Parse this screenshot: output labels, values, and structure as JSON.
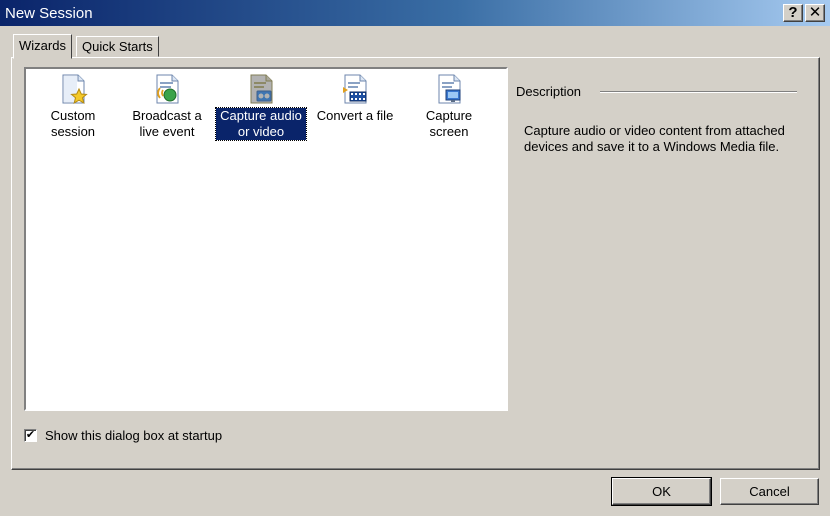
{
  "window": {
    "title": "New Session",
    "help_label": "?",
    "close_label": "✕"
  },
  "tabs": [
    {
      "label": "Wizards",
      "active": true
    },
    {
      "label": "Quick Starts",
      "active": false
    }
  ],
  "wizards": [
    {
      "label": "Custom session",
      "icon": "custom-session-icon",
      "selected": false
    },
    {
      "label": "Broadcast a live event",
      "icon": "broadcast-icon",
      "selected": false
    },
    {
      "label": "Capture audio or video",
      "icon": "capture-av-icon",
      "selected": true
    },
    {
      "label": "Convert a file",
      "icon": "convert-file-icon",
      "selected": false
    },
    {
      "label": "Capture screen",
      "icon": "capture-screen-icon",
      "selected": false
    }
  ],
  "description": {
    "title": "Description",
    "text": "Capture audio or video content from attached devices and save it to a Windows Media file."
  },
  "startup_checkbox": {
    "label": "Show this dialog box at startup",
    "checked": true,
    "mark": "✔"
  },
  "buttons": {
    "ok": "OK",
    "cancel": "Cancel"
  },
  "colors": {
    "title_bar": "#0a246a",
    "dialog_face": "#d4d0c8",
    "selection": "#0a246a"
  }
}
